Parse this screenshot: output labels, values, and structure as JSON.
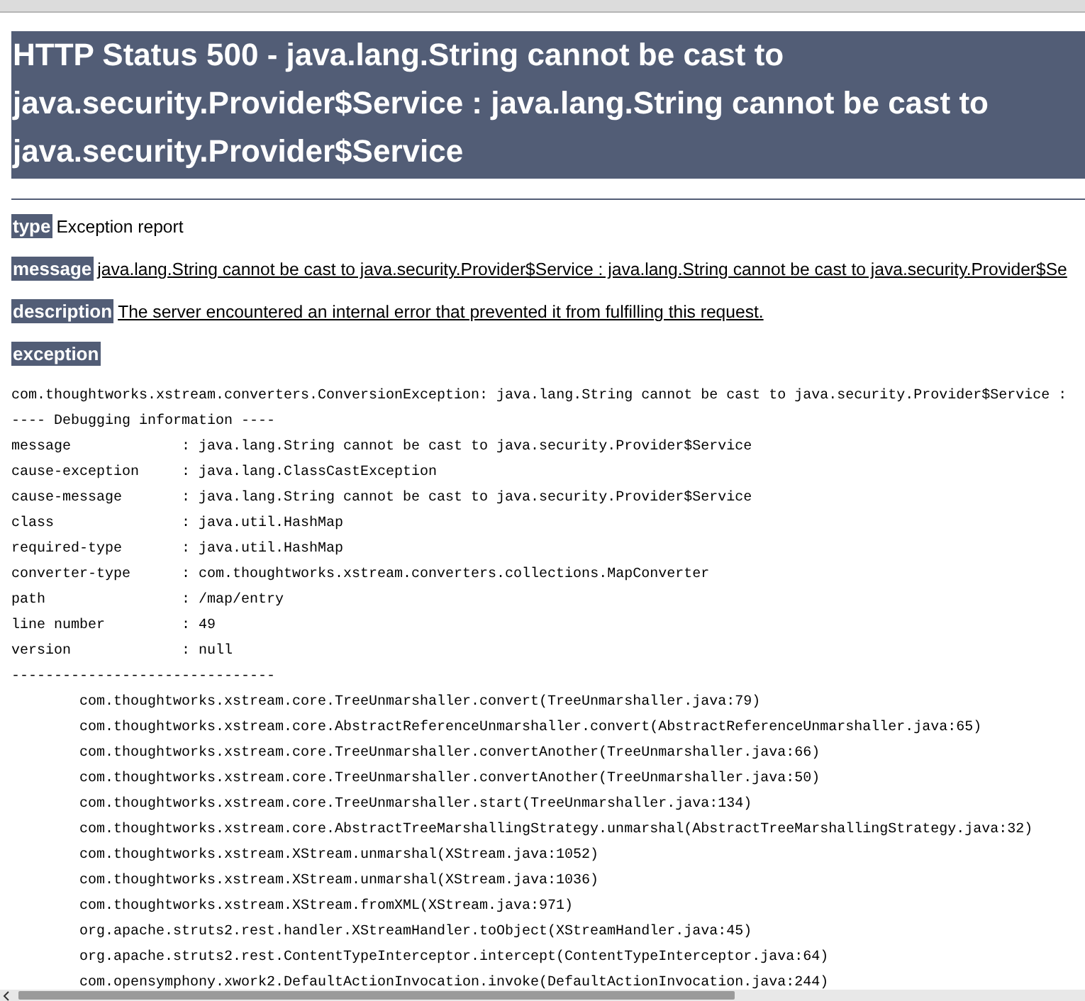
{
  "title": "HTTP Status 500 - java.lang.String cannot be cast to java.security.Provider$Service : java.lang.String cannot be cast to java.security.Provider$Service",
  "fields": [
    {
      "kind": "plain",
      "label": "type",
      "value": "Exception report"
    },
    {
      "kind": "underlined",
      "label": "message",
      "value": "java.lang.String cannot be cast to java.security.Provider$Service : java.lang.String cannot be cast to java.security.Provider$Se"
    },
    {
      "kind": "underlined",
      "label": "description",
      "value": "The server encountered an internal error that prevented it from fulfilling this request."
    },
    {
      "kind": "heading",
      "label": "exception"
    }
  ],
  "exception": [
    {
      "kind": "text",
      "text": "com.thoughtworks.xstream.converters.ConversionException: java.lang.String cannot be cast to java.security.Provider$Service :"
    },
    {
      "kind": "text",
      "text": "---- Debugging information ----"
    },
    {
      "kind": "field",
      "key": "message",
      "value": ": java.lang.String cannot be cast to java.security.Provider$Service"
    },
    {
      "kind": "field",
      "key": "cause-exception",
      "value": ": java.lang.ClassCastException"
    },
    {
      "kind": "field",
      "key": "cause-message",
      "value": ": java.lang.String cannot be cast to java.security.Provider$Service"
    },
    {
      "kind": "field",
      "key": "class",
      "value": ": java.util.HashMap"
    },
    {
      "kind": "field",
      "key": "required-type",
      "value": ": java.util.HashMap"
    },
    {
      "kind": "field",
      "key": "converter-type",
      "value": ": com.thoughtworks.xstream.converters.collections.MapConverter"
    },
    {
      "kind": "field",
      "key": "path",
      "value": ": /map/entry"
    },
    {
      "kind": "field",
      "key": "line number",
      "value": ": 49"
    },
    {
      "kind": "field",
      "key": "version",
      "value": ": null"
    },
    {
      "kind": "text",
      "text": "-------------------------------"
    },
    {
      "kind": "frame",
      "text": "com.thoughtworks.xstream.core.TreeUnmarshaller.convert(TreeUnmarshaller.java:79)"
    },
    {
      "kind": "frame",
      "text": "com.thoughtworks.xstream.core.AbstractReferenceUnmarshaller.convert(AbstractReferenceUnmarshaller.java:65)"
    },
    {
      "kind": "frame",
      "text": "com.thoughtworks.xstream.core.TreeUnmarshaller.convertAnother(TreeUnmarshaller.java:66)"
    },
    {
      "kind": "frame",
      "text": "com.thoughtworks.xstream.core.TreeUnmarshaller.convertAnother(TreeUnmarshaller.java:50)"
    },
    {
      "kind": "frame",
      "text": "com.thoughtworks.xstream.core.TreeUnmarshaller.start(TreeUnmarshaller.java:134)"
    },
    {
      "kind": "frame",
      "text": "com.thoughtworks.xstream.core.AbstractTreeMarshallingStrategy.unmarshal(AbstractTreeMarshallingStrategy.java:32)"
    },
    {
      "kind": "frame",
      "text": "com.thoughtworks.xstream.XStream.unmarshal(XStream.java:1052)"
    },
    {
      "kind": "frame",
      "text": "com.thoughtworks.xstream.XStream.unmarshal(XStream.java:1036)"
    },
    {
      "kind": "frame",
      "text": "com.thoughtworks.xstream.XStream.fromXML(XStream.java:971)"
    },
    {
      "kind": "frame",
      "text": "org.apache.struts2.rest.handler.XStreamHandler.toObject(XStreamHandler.java:45)"
    },
    {
      "kind": "frame",
      "text": "org.apache.struts2.rest.ContentTypeInterceptor.intercept(ContentTypeInterceptor.java:64)"
    },
    {
      "kind": "frame",
      "text": "com.opensymphony.xwork2.DefaultActionInvocation.invoke(DefaultActionInvocation.java:244)"
    }
  ]
}
